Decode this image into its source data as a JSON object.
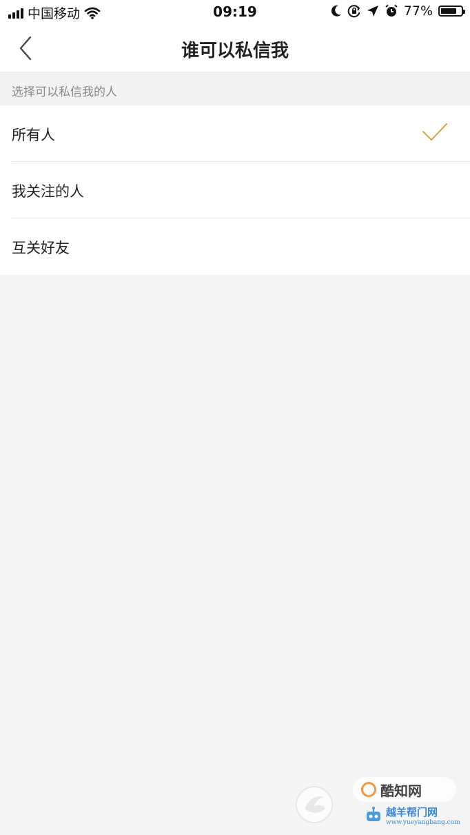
{
  "status_bar": {
    "carrier": "中国移动",
    "time": "09:19",
    "battery_percent": "77%",
    "battery_level": 0.77,
    "icons": [
      "signal-icon",
      "wifi-icon",
      "moon-icon",
      "orientation-lock-icon",
      "location-icon",
      "alarm-icon",
      "battery-icon"
    ]
  },
  "nav": {
    "title": "谁可以私信我",
    "back_icon": "chevron-left-icon"
  },
  "section": {
    "header": "选择可以私信我的人"
  },
  "options": [
    {
      "label": "所有人",
      "selected": true
    },
    {
      "label": "我关注的人",
      "selected": false
    },
    {
      "label": "互关好友",
      "selected": false
    }
  ],
  "watermark": {
    "logo_text": "酷知网",
    "site_text": "越羊帮门网",
    "url": "www.yueyangbang.com"
  },
  "colors": {
    "accent_check": "#d9a24a",
    "background": "#f4f4f4",
    "watermark_orange": "#f08a24",
    "watermark_blue": "#1b73c9"
  }
}
